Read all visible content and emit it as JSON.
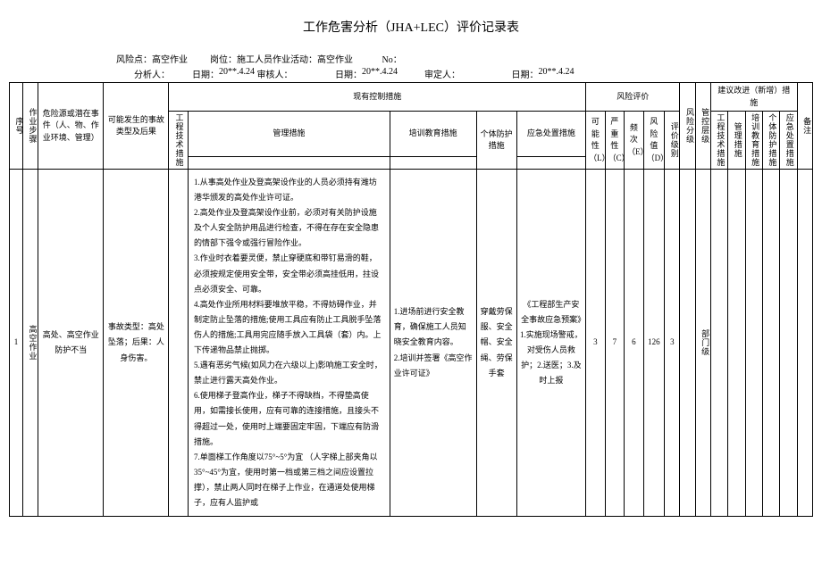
{
  "title": "工作危害分析（JHA+LEC）评价记录表",
  "meta": {
    "risk_point_label": "风险点：",
    "risk_point": "高空作业",
    "post_label": "岗位：",
    "post": "施工人员作业活动：",
    "activity": "高空作业",
    "no_label": "No：",
    "analyst_label": "分析人：",
    "date_label": "日期：",
    "date1": "20**.4.24",
    "auditor_label": "审核人：",
    "date2": "20**.4.24",
    "approver_label": "审定人：",
    "date3": "20**.4.24"
  },
  "headers": {
    "seq": "序号",
    "step": "作业步骤",
    "hazard": "危险源或潜在事件（人、物、作业环境、管理）",
    "accident": "可能发生的事故类型及后果",
    "existing": "现有控制措施",
    "eng": "工程技术措施",
    "mgmt": "管理措施",
    "training": "培训教育措施",
    "ppe": "个体防护措施",
    "emergency": "应急处置措施",
    "risk_eval": "风险评价",
    "L": "可能性（L）",
    "C": "严重性（C）",
    "E": "频次（E）",
    "D": "风险值（D）",
    "level": "评价级别",
    "risk_level": "风险分级",
    "ctrl_level": "管控层级",
    "suggest": "建议改进（新增）措施",
    "s_eng": "工程技术措施",
    "s_mgmt": "管理措施",
    "s_train": "培训教育措施",
    "s_ppe": "个体防护措施",
    "s_emerg": "应急处置措施",
    "remark": "备注"
  },
  "row": {
    "seq": "1",
    "step": "高空作业",
    "hazard": "高处、高空作业防护不当",
    "accident": "事故类型：高处坠落；后果：人身伤害。",
    "eng": "",
    "mgmt": "1.从事高处作业及登高架设作业的人员必须持有潍坊港华颁发的高处作业许可证。\n2.高处作业及登高架设作业前，必须对有关防护设施及个人安全防护用品进行检查，不得在存在安全隐患的情部下强令或强行冒险作业。\n3.作业时衣着要灵便，禁止穿硬底和带钉易滑的鞋，必须按规定使用安全带，安全带必须高挂低用，拄设点必须安全、可靠。\n4.高处作业所用材料要堆放平稳，不得妨碍作业，并制定防止坠落的措施;使用工具应有防止工具脱手坠落伤人的措施;工具用完应随手放入工具袋（套）内。上下传递物品禁止抛掷。\n5.遇有恶劣气候(如风力在六级以上)影响施工安全时，禁止进行露天高处作业。\n6.使用梯子登高作业，梯子不得缺档，不得垫高使用，如需接长使用，应有可靠的连接措施，且接头不得超过一处，使用时上端要固定牢固，下端应有防滑措施。\n7.单面梯工作角度以75°~5°为宜 （人字梯上部夹角以35°~45°为宜，使用时第一档或第三档之间应设置拉撑），禁止两人同时在梯子上作业，在通道处使用梯子，应有人监护或",
    "training": "1.进场前进行安全教育，确保施工人员知晓安全教育内容。\n2.培训并签署《高空作业许可证》",
    "ppe": "穿戴劳保服、安全帽、安全绳、劳保手套",
    "emergency": "《工程部生产安全事故应急预案》1.实施现场警戒，对受伤人员救护；2.送医；3.及时上报",
    "L": "3",
    "C": "7",
    "E": "6",
    "D": "126",
    "level": "3",
    "risk_level": "",
    "ctrl_level": "部门级",
    "s_eng": "",
    "s_mgmt": "",
    "s_train": "",
    "s_ppe": "",
    "s_emerg": "",
    "remark": ""
  }
}
